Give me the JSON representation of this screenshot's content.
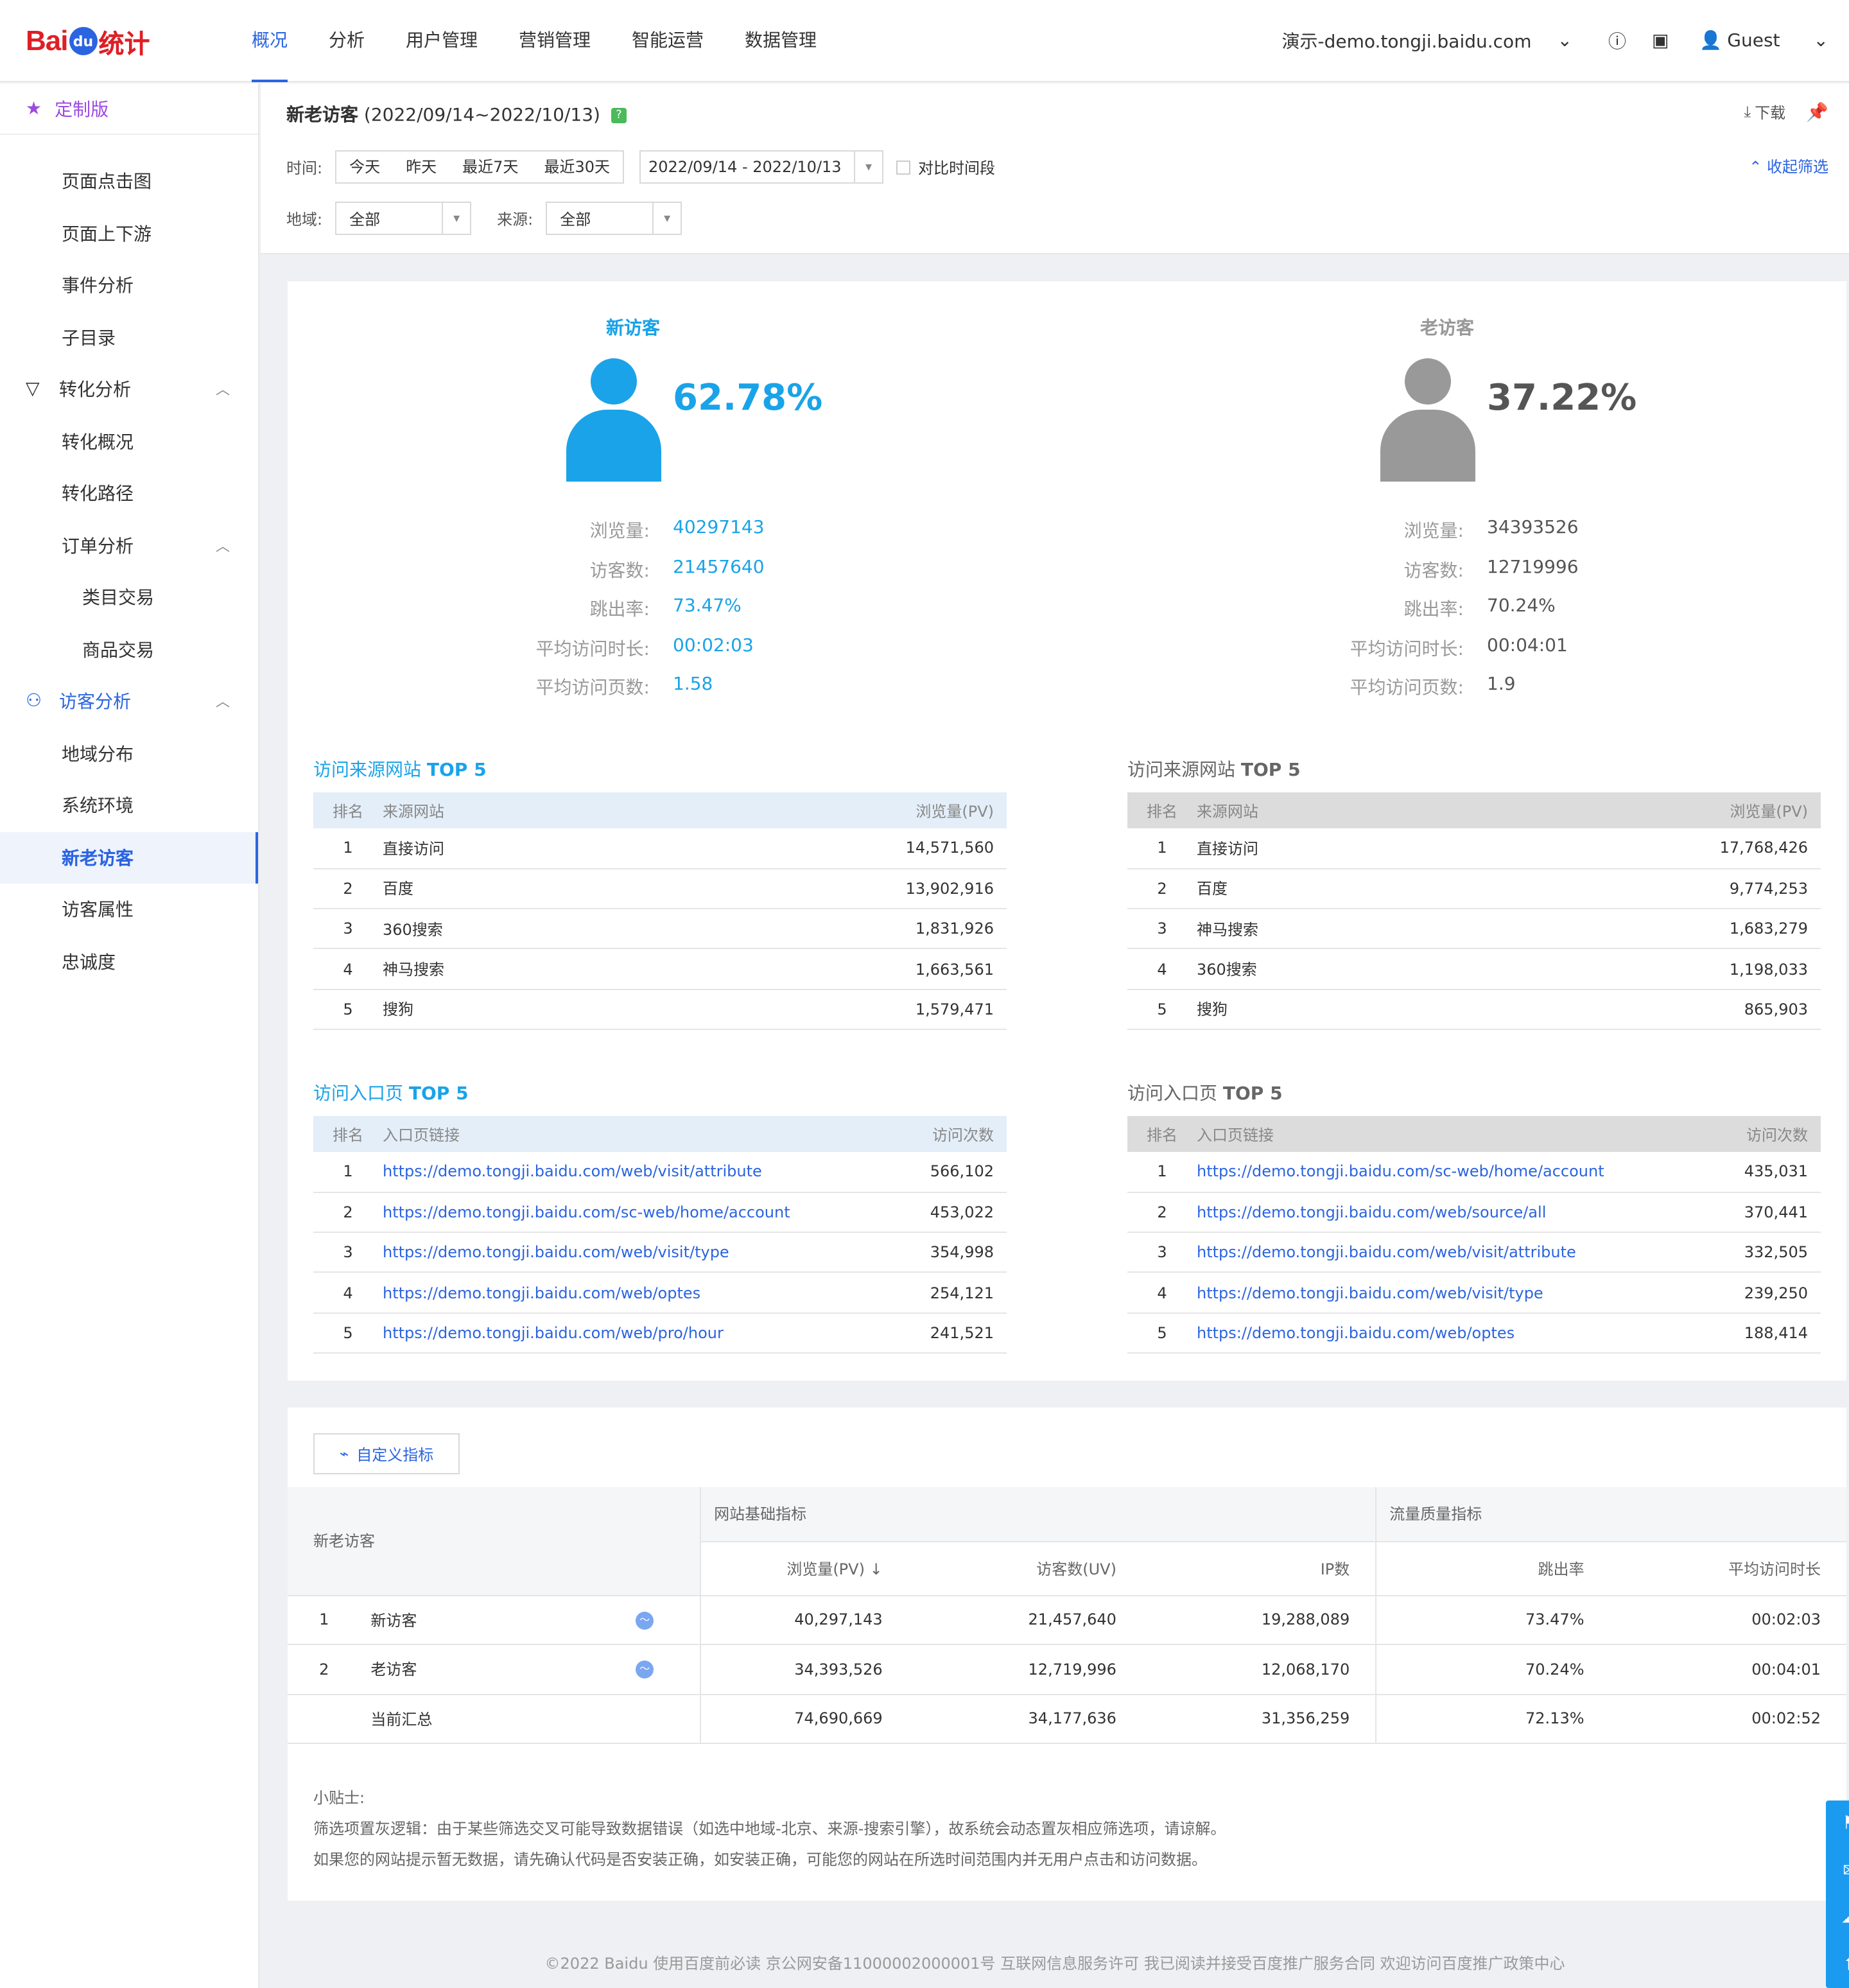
{
  "brand": {
    "logo_left": "Bai",
    "logo_mid": "du",
    "logo_right": "统计"
  },
  "nav": {
    "items": [
      "概况",
      "分析",
      "用户管理",
      "营销管理",
      "智能运营",
      "数据管理"
    ],
    "active_index": 0
  },
  "topbar": {
    "site": "演示-demo.tongji.baidu.com",
    "user": "Guest"
  },
  "sidebar": {
    "head": "定制版",
    "items": [
      {
        "label": "页面点击图",
        "level": 2
      },
      {
        "label": "页面上下游",
        "level": 2
      },
      {
        "label": "事件分析",
        "level": 2
      },
      {
        "label": "子目录",
        "level": 2
      },
      {
        "label": "转化分析",
        "level": 1,
        "icon": "funnel-icon"
      },
      {
        "label": "转化概况",
        "level": 2
      },
      {
        "label": "转化路径",
        "level": 2
      },
      {
        "label": "订单分析",
        "level": 2,
        "expand": true
      },
      {
        "label": "类目交易",
        "level": 3
      },
      {
        "label": "商品交易",
        "level": 3
      },
      {
        "label": "访客分析",
        "level": 1,
        "icon": "user-icon",
        "blue": true
      },
      {
        "label": "地域分布",
        "level": 2
      },
      {
        "label": "系统环境",
        "level": 2
      },
      {
        "label": "新老访客",
        "level": 2,
        "active": true
      },
      {
        "label": "访客属性",
        "level": 2
      },
      {
        "label": "忠诚度",
        "level": 2
      }
    ]
  },
  "filter": {
    "title": "新老访客",
    "range": "(2022/09/14~2022/10/13)",
    "download": "下载",
    "time_label": "时间:",
    "quick": [
      "今天",
      "昨天",
      "最近7天",
      "最近30天"
    ],
    "date_range": "2022/09/14 - 2022/10/13",
    "compare": "对比时间段",
    "collapse": "收起筛选",
    "region_label": "地域:",
    "region_value": "全部",
    "source_label": "来源:",
    "source_value": "全部"
  },
  "colors": {
    "new": "#1aa3e8",
    "old": "#999999",
    "accent": "#2b64e0"
  },
  "new": {
    "title": "新访客",
    "pct": "62.78%",
    "stats": [
      {
        "label": "浏览量:",
        "value": "40297143"
      },
      {
        "label": "访客数:",
        "value": "21457640"
      },
      {
        "label": "跳出率:",
        "value": "73.47%"
      },
      {
        "label": "平均访问时长:",
        "value": "00:02:03"
      },
      {
        "label": "平均访问页数:",
        "value": "1.58"
      }
    ],
    "src_title_a": "访问来源网站 ",
    "src_title_b": "TOP 5",
    "src_headers": [
      "排名",
      "来源网站",
      "浏览量(PV)"
    ],
    "src_rows": [
      [
        "1",
        "直接访问",
        "14,571,560"
      ],
      [
        "2",
        "百度",
        "13,902,916"
      ],
      [
        "3",
        "360搜索",
        "1,831,926"
      ],
      [
        "4",
        "神马搜索",
        "1,663,561"
      ],
      [
        "5",
        "搜狗",
        "1,579,471"
      ]
    ],
    "entry_title_a": "访问入口页 ",
    "entry_title_b": "TOP 5",
    "entry_headers": [
      "排名",
      "入口页链接",
      "访问次数"
    ],
    "entry_rows": [
      [
        "1",
        "https://demo.tongji.baidu.com/web/visit/attribute",
        "566,102"
      ],
      [
        "2",
        "https://demo.tongji.baidu.com/sc-web/home/account",
        "453,022"
      ],
      [
        "3",
        "https://demo.tongji.baidu.com/web/visit/type",
        "354,998"
      ],
      [
        "4",
        "https://demo.tongji.baidu.com/web/optes",
        "254,121"
      ],
      [
        "5",
        "https://demo.tongji.baidu.com/web/pro/hour",
        "241,521"
      ]
    ]
  },
  "old": {
    "title": "老访客",
    "pct": "37.22%",
    "stats": [
      {
        "label": "浏览量:",
        "value": "34393526"
      },
      {
        "label": "访客数:",
        "value": "12719996"
      },
      {
        "label": "跳出率:",
        "value": "70.24%"
      },
      {
        "label": "平均访问时长:",
        "value": "00:04:01"
      },
      {
        "label": "平均访问页数:",
        "value": "1.9"
      }
    ],
    "src_title_a": "访问来源网站 ",
    "src_title_b": "TOP 5",
    "src_headers": [
      "排名",
      "来源网站",
      "浏览量(PV)"
    ],
    "src_rows": [
      [
        "1",
        "直接访问",
        "17,768,426"
      ],
      [
        "2",
        "百度",
        "9,774,253"
      ],
      [
        "3",
        "神马搜索",
        "1,683,279"
      ],
      [
        "4",
        "360搜索",
        "1,198,033"
      ],
      [
        "5",
        "搜狗",
        "865,903"
      ]
    ],
    "entry_title_a": "访问入口页 ",
    "entry_title_b": "TOP 5",
    "entry_headers": [
      "排名",
      "入口页链接",
      "访问次数"
    ],
    "entry_rows": [
      [
        "1",
        "https://demo.tongji.baidu.com/sc-web/home/account",
        "435,031"
      ],
      [
        "2",
        "https://demo.tongji.baidu.com/web/source/all",
        "370,441"
      ],
      [
        "3",
        "https://demo.tongji.baidu.com/web/visit/attribute",
        "332,505"
      ],
      [
        "4",
        "https://demo.tongji.baidu.com/web/visit/type",
        "239,250"
      ],
      [
        "5",
        "https://demo.tongji.baidu.com/web/optes",
        "188,414"
      ]
    ]
  },
  "metrics": {
    "custom_btn": "自定义指标",
    "group_col": "新老访客",
    "group_basic": "网站基础指标",
    "group_quality": "流量质量指标",
    "cols": [
      "浏览量(PV)",
      "访客数(UV)",
      "IP数",
      "跳出率",
      "平均访问时长"
    ],
    "rows": [
      {
        "idx": "1",
        "name": "新访客",
        "vals": [
          "40,297,143",
          "21,457,640",
          "19,288,089",
          "73.47%",
          "00:02:03"
        ]
      },
      {
        "idx": "2",
        "name": "老访客",
        "vals": [
          "34,393,526",
          "12,719,996",
          "12,068,170",
          "70.24%",
          "00:04:01"
        ]
      }
    ],
    "total": {
      "name": "当前汇总",
      "vals": [
        "74,690,669",
        "34,177,636",
        "31,356,259",
        "72.13%",
        "00:02:52"
      ]
    }
  },
  "tips": {
    "title": "小贴士:",
    "line1": "筛选项置灰逻辑：由于某些筛选交叉可能导致数据错误（如选中地域-北京、来源-搜索引擎），故系统会动态置灰相应筛选项，请谅解。",
    "line2": "如果您的网站提示暂无数据，请先确认代码是否安装正确，如安装正确，可能您的网站在所选时间范围内并无用户点击和访问数据。"
  },
  "footer": "©2022 Baidu 使用百度前必读 京公网安备11000002000001号 互联网信息服务许可 我已阅读并接受百度推广服务合同 欢迎访问百度推广政策中心"
}
